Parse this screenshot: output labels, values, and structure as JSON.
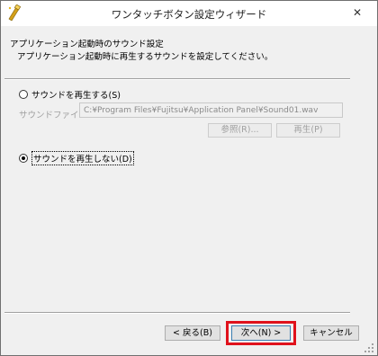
{
  "window": {
    "title": "ワンタッチボタン設定ウィザード",
    "close_glyph": "✕"
  },
  "header": {
    "title": "アプリケーション起動時のサウンド設定",
    "subtitle": "アプリケーション起動時に再生するサウンドを設定してください。"
  },
  "options": {
    "play_sound_label": "サウンドを再生する(S)",
    "no_sound_label": "サウンドを再生しない(D)",
    "selected": "no_sound"
  },
  "sound_file": {
    "label": "サウンドファイル:",
    "value": "C:¥Program Files¥Fujitsu¥Application Panel¥Sound01.wav"
  },
  "buttons": {
    "browse": "参照(R)...",
    "play": "再生(P)",
    "back": "< 戻る(B)",
    "next": "次へ(N) >",
    "cancel": "キャンセル"
  },
  "colors": {
    "highlight": "#e0121c",
    "disabled_text": "#a0a0a0"
  }
}
